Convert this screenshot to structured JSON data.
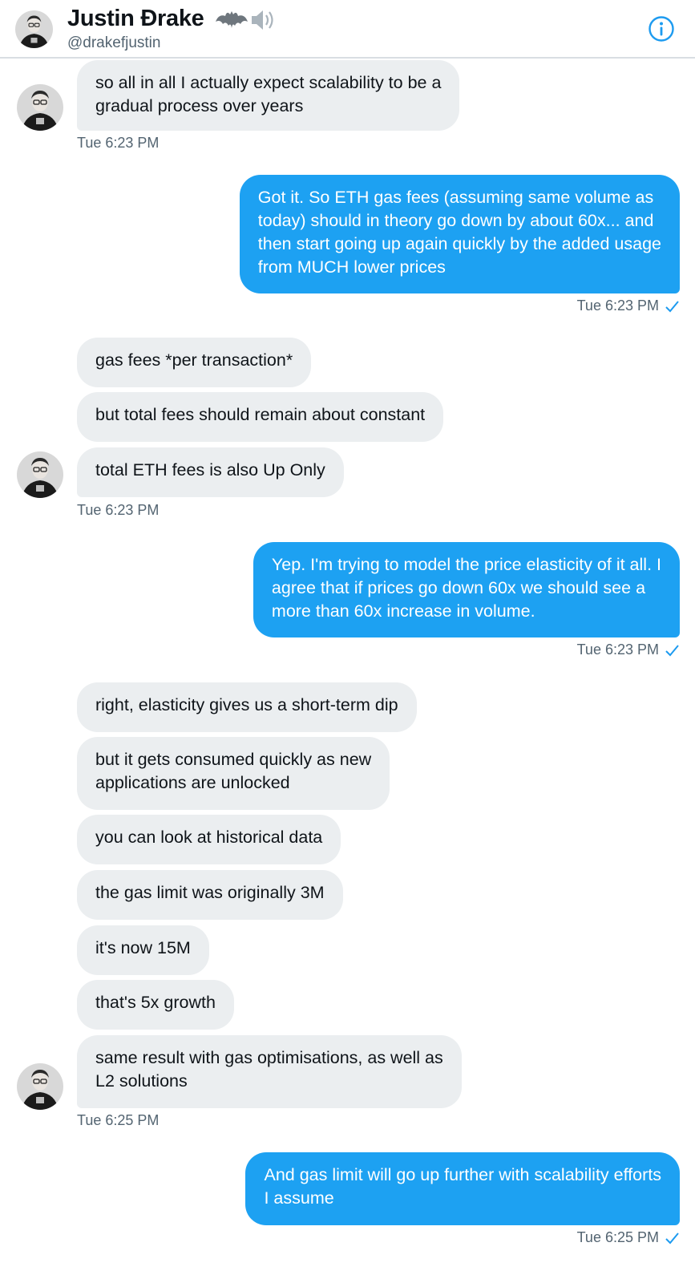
{
  "header": {
    "name": "Justin Ðrake",
    "handle": "@drakefjustin",
    "emoji": [
      "bat-emoji",
      "speaker-emoji"
    ],
    "info_icon": "info-icon"
  },
  "messages": [
    {
      "dir": "in",
      "text": "so all in all I actually expect scalability to be a\ngradual process over years"
    },
    {
      "dir": "in",
      "stamp": "Tue 6:23 PM"
    },
    {
      "dir": "out",
      "text": "Got it. So ETH gas fees (assuming same volume as\ntoday) should in theory go down by about 60x... and\nthen start going up again quickly by the added usage\nfrom MUCH lower prices"
    },
    {
      "dir": "out",
      "stamp": "Tue 6:23 PM"
    },
    {
      "dir": "in",
      "text": "gas fees *per transaction*"
    },
    {
      "dir": "in",
      "text": "but total fees should remain about constant"
    },
    {
      "dir": "in",
      "text": "total ETH fees is also Up Only"
    },
    {
      "dir": "in",
      "stamp": "Tue 6:23 PM"
    },
    {
      "dir": "out",
      "text": "Yep. I'm trying to model the price elasticity of it all. I\nagree that if prices go down 60x we should see a\nmore than 60x increase in volume."
    },
    {
      "dir": "out",
      "stamp": "Tue 6:23 PM"
    },
    {
      "dir": "in",
      "text": "right, elasticity gives us a short-term dip"
    },
    {
      "dir": "in",
      "text": "but it gets consumed quickly as new\napplications are unlocked"
    },
    {
      "dir": "in",
      "text": "you can look at historical data"
    },
    {
      "dir": "in",
      "text": "the gas limit was originally 3M"
    },
    {
      "dir": "in",
      "text": "it's now 15M"
    },
    {
      "dir": "in",
      "text": "that's 5x growth"
    },
    {
      "dir": "in",
      "text": "same result with gas optimisations, as well as\nL2 solutions"
    },
    {
      "dir": "in",
      "stamp": "Tue 6:25 PM"
    },
    {
      "dir": "out",
      "text": "And gas limit will go up further with scalability efforts\nI assume"
    },
    {
      "dir": "out",
      "stamp": "Tue 6:25 PM"
    }
  ],
  "colors": {
    "outgoing_bubble": "#1da1f2",
    "incoming_bubble": "#ebeef0",
    "timestamp": "#536471",
    "accent": "#1d9bf0"
  }
}
